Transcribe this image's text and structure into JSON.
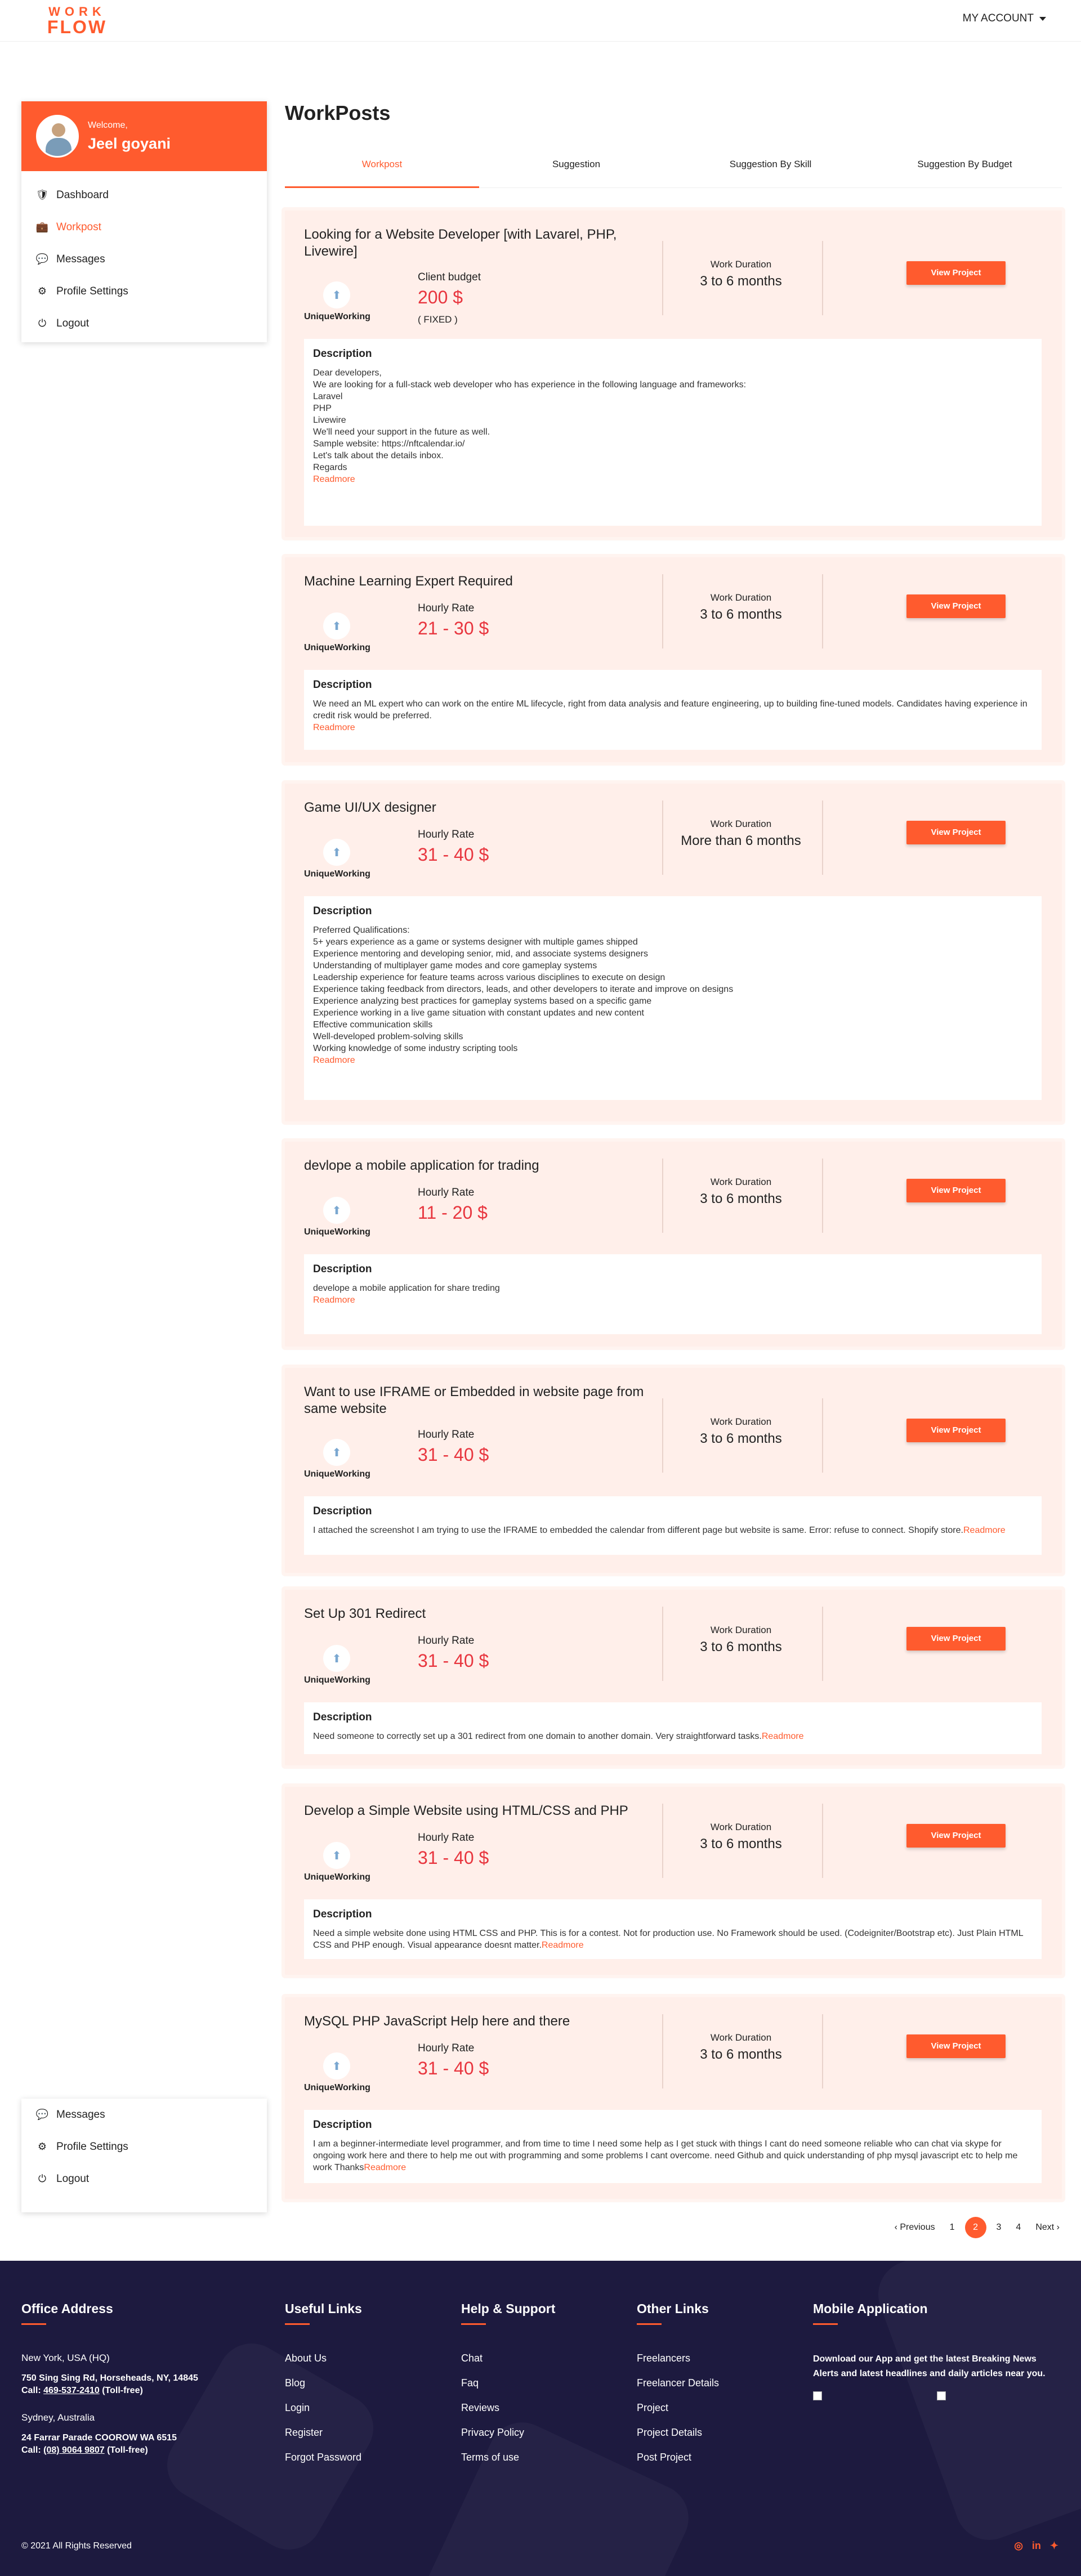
{
  "header": {
    "logo_line1": "WORK",
    "logo_line2": "FLOW",
    "account_label": "MY ACCOUNT"
  },
  "sidebar": {
    "welcome": "Welcome,",
    "user_name": "Jeel goyani",
    "items": [
      {
        "label": "Dashboard",
        "icon": "shield-check-icon"
      },
      {
        "label": "Workpost",
        "icon": "briefcase-icon",
        "active": true
      },
      {
        "label": "Messages",
        "icon": "chat-icon"
      },
      {
        "label": "Profile Settings",
        "icon": "gear-icon"
      },
      {
        "label": "Logout",
        "icon": "power-icon"
      }
    ]
  },
  "page": {
    "title": "WorkPosts",
    "tabs": [
      "Workpost",
      "Suggestion",
      "Suggestion By Skill",
      "Suggestion By Budget"
    ]
  },
  "common": {
    "company": "UniqueWorking",
    "duration_label": "Work Duration",
    "view_button": "View Project",
    "description_label": "Description",
    "readmore": "Readmore"
  },
  "jobs": [
    {
      "title": "Looking for a Website Developer [with Lavarel, PHP, Livewire]",
      "rate_label": "Client budget",
      "rate": "200 $",
      "rate_note": "( FIXED )",
      "duration": "3 to 6 months",
      "description": "Dear developers,\nWe are looking for a full-stack web developer who has experience in the following language and frameworks:\nLaravel\nPHP\nLivewire\nWe'll need your support in the future as well.\nSample website: https://nftcalendar.io/\nLet's talk about the details inbox.\nRegards"
    },
    {
      "title": "Machine Learning Expert Required",
      "rate_label": "Hourly Rate",
      "rate": "21 - 30 $",
      "duration": "3 to 6 months",
      "description": "We need an ML expert who can work on the entire ML lifecycle, right from data analysis and feature engineering, up to building fine-tuned models. Candidates having experience in credit risk would be preferred."
    },
    {
      "title": "Game UI/UX designer",
      "rate_label": "Hourly Rate",
      "rate": "31 - 40 $",
      "duration": "More than 6 months",
      "description": "Preferred Qualifications:\n5+ years experience as a game or systems designer with multiple games shipped\nExperience mentoring and developing senior, mid, and associate systems designers\nUnderstanding of multiplayer game modes and core gameplay systems\nLeadership experience for feature teams across various disciplines to execute on design\nExperience taking feedback from directors, leads, and other developers to iterate and improve on designs\nExperience analyzing best practices for gameplay systems based on a specific game\nExperience working in a live game situation with constant updates and new content\nEffective communication skills\nWell-developed problem-solving skills\nWorking knowledge of some industry scripting tools"
    },
    {
      "title": "devlope a mobile application for trading",
      "rate_label": "Hourly Rate",
      "rate": "11 - 20 $",
      "duration": "3 to 6 months",
      "description": "develope a mobile application for share treding"
    },
    {
      "title": "Want to use IFRAME or Embedded in website page from same website",
      "rate_label": "Hourly Rate",
      "rate": "31 - 40 $",
      "duration": "3 to 6 months",
      "description": "I attached the screenshot I am trying to use the IFRAME to embedded the calendar from different page but website is same. Error: refuse to connect. Shopify store."
    },
    {
      "title": "Set Up 301 Redirect",
      "rate_label": "Hourly Rate",
      "rate": "31 - 40 $",
      "duration": "3 to 6 months",
      "description": "Need someone to correctly set up a 301 redirect from one domain to another domain. Very straightforward tasks."
    },
    {
      "title": "Develop a Simple Website using HTML/CSS and PHP",
      "rate_label": "Hourly Rate",
      "rate": "31 - 40 $",
      "duration": "3 to 6 months",
      "description": "Need a simple website done using HTML CSS and PHP. This is for a contest. Not for production use. No Framework should be used. (Codeigniter/Bootstrap etc). Just Plain HTML CSS and PHP enough. Visual appearance doesnt matter."
    },
    {
      "title": "MySQL PHP JavaScript Help here and there",
      "rate_label": "Hourly Rate",
      "rate": "31 - 40 $",
      "duration": "3 to 6 months",
      "description": "I am a beginner-intermediate level programmer, and from time to time I need some help as I get stuck with things I cant do need someone reliable who can chat via skype for ongoing work here and there to help me out with programming and some problems I cant overcome. need Github and quick understanding of php mysql javascript etc to help me work Thanks"
    }
  ],
  "pagination": {
    "prev": "‹ Previous",
    "pages": [
      "1",
      "2",
      "3",
      "4"
    ],
    "current": "2",
    "next": "Next ›"
  },
  "footer": {
    "office": {
      "title": "Office Address",
      "hq_city": "New York, USA (HQ)",
      "hq_street": "750 Sing Sing Rd, Horseheads, NY, 14845",
      "hq_call_prefix": "Call: ",
      "hq_phone": "469-537-2410",
      "hq_call_suffix": " (Toll-free)",
      "au_city": "Sydney, Australia",
      "au_street": "24 Farrar Parade COOROW WA 6515",
      "au_call_prefix": "Call: ",
      "au_phone": "(08) 9064 9807",
      "au_call_suffix": " (Toll-free)"
    },
    "useful_links": {
      "title": "Useful Links",
      "items": [
        "About Us",
        "Blog",
        "Login",
        "Register",
        "Forgot Password"
      ]
    },
    "help": {
      "title": "Help & Support",
      "items": [
        "Chat",
        "Faq",
        "Reviews",
        "Privacy Policy",
        "Terms of use"
      ]
    },
    "other": {
      "title": "Other Links",
      "items": [
        "Freelancers",
        "Freelancer Details",
        "Project",
        "Project Details",
        "Post Project"
      ]
    },
    "mobile": {
      "title": "Mobile Application",
      "text": "Download our App and get the latest Breaking News Alerts and latest headlines and daily articles near you."
    },
    "copyright": "© 2021 All Rights Reserved",
    "social": [
      "instagram-icon",
      "linkedin-icon",
      "twitter-icon"
    ]
  },
  "colors": {
    "accent": "#ff5b2e",
    "rate": "#e8363f",
    "footer_bg": "#1d1a3f",
    "card_bg": "#ffefea"
  }
}
